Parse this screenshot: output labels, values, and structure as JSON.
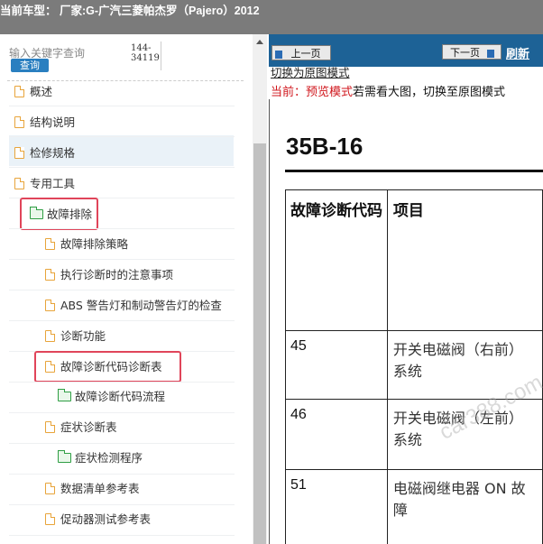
{
  "header": {
    "title": "当前车型：  厂家:G-广汽三菱帕杰罗（Pajero）2012"
  },
  "search": {
    "placeholder": "输入关键字查询",
    "button_label": "查询"
  },
  "page_range": {
    "line1": "144-",
    "line2": "34119"
  },
  "tree": [
    {
      "label": "概述",
      "icon": "document-icon"
    },
    {
      "label": "结构说明",
      "icon": "document-icon"
    },
    {
      "label": "检修规格",
      "icon": "document-icon"
    },
    {
      "label": "专用工具",
      "icon": "document-icon"
    },
    {
      "label": "故障排除",
      "icon": "folder-open-icon"
    },
    {
      "label": "故障排除策略",
      "icon": "document-icon"
    },
    {
      "label": "执行诊断时的注意事项",
      "icon": "document-icon"
    },
    {
      "label": "ABS 警告灯和制动警告灯的检查",
      "icon": "document-icon"
    },
    {
      "label": "诊断功能",
      "icon": "document-icon"
    },
    {
      "label": "故障诊断代码诊断表",
      "icon": "document-icon"
    },
    {
      "label": "故障诊断代码流程",
      "icon": "folder-icon"
    },
    {
      "label": "症状诊断表",
      "icon": "document-icon"
    },
    {
      "label": "症状检测程序",
      "icon": "folder-icon"
    },
    {
      "label": "数据清单参考表",
      "icon": "document-icon"
    },
    {
      "label": "促动器测试参考表",
      "icon": "document-icon"
    }
  ],
  "viewer": {
    "prev_label": "上一页",
    "next_label": "下一页",
    "refresh_label": "刷新",
    "link_label": "切换为原图模式",
    "mode_prefix": "当前：预览模式",
    "mode_suffix": "若需看大图，切换至原图模式",
    "section_title": "35B-16",
    "table": {
      "headers": [
        "故障诊断代码",
        "项目"
      ],
      "rows": [
        {
          "code": "45",
          "item": "开关电磁阀（右前）系统"
        },
        {
          "code": "46",
          "item": "开关电磁阀（左前）系统"
        },
        {
          "code": "51",
          "item": "电磁阀继电器 ON 故障"
        }
      ]
    },
    "watermark": "car388.com"
  }
}
